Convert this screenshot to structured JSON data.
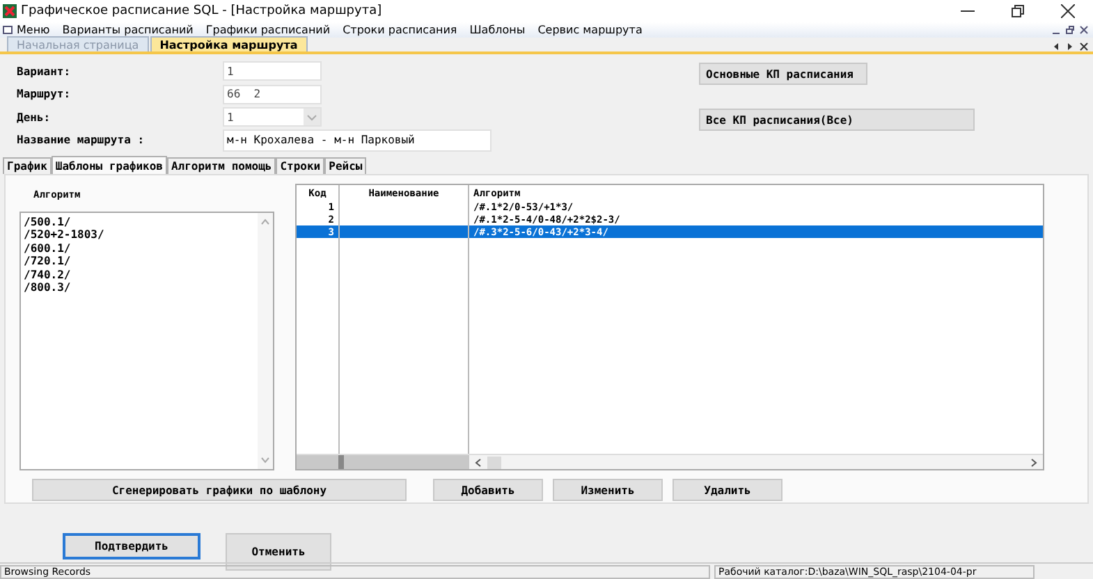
{
  "window": {
    "title": "Графическое расписание SQL - [Настройка маршрута]"
  },
  "menu": [
    "Меню",
    "Варианты расписаний",
    "Графики расписаний",
    "Строки расписания",
    "Шаблоны",
    "Сервис маршрута"
  ],
  "doc_tabs": [
    {
      "label": "Начальная страница",
      "selected": false
    },
    {
      "label": "Настройка маршрута",
      "selected": true
    }
  ],
  "fields": [
    {
      "label": "Вариант:",
      "value": "1",
      "kind": "text"
    },
    {
      "label": "Маршрут:",
      "value": "66  2",
      "kind": "text"
    },
    {
      "label": "День:",
      "value": "1",
      "kind": "select"
    },
    {
      "label": "Название маршрута :",
      "value": "м-н Крохалева - м-н Парковый",
      "kind": "wide"
    }
  ],
  "side_buttons": [
    "Основные КП расписания",
    "Все КП расписания(Все)"
  ],
  "tabs": [
    {
      "label": "График",
      "selected": false
    },
    {
      "label": "Шаблоны графиков",
      "selected": true
    },
    {
      "label": "Алгоритм помощь",
      "selected": false
    },
    {
      "label": "Строки",
      "selected": false
    },
    {
      "label": "Рейсы",
      "selected": false
    }
  ],
  "algorithms": {
    "header": "Алгоритм",
    "items": [
      "/500.1/",
      "/520+2-1803/",
      "/600.1/",
      "/720.1/",
      "/740.2/",
      "/800.3/"
    ]
  },
  "table": {
    "columns": [
      "Код",
      "Наименование",
      "Алгоритм"
    ],
    "rows": [
      {
        "cells": [
          "1",
          "",
          "/#.1*2/0-53/+1*3/"
        ],
        "selected": false
      },
      {
        "cells": [
          "2",
          "",
          "/#.1*2-5-4/0-48/+2*2$2-3/"
        ],
        "selected": false
      },
      {
        "cells": [
          "3",
          "",
          "/#.3*2-5-6/0-43/+2*3-4/"
        ],
        "selected": true
      }
    ]
  },
  "panel_buttons": [
    "Сгенерировать графики по шаблону",
    "Добавить",
    "Изменить",
    "Удалить"
  ],
  "dialog_buttons": [
    {
      "label": "Подтвердить",
      "focused": true
    },
    {
      "label": "Отменить",
      "focused": false
    }
  ],
  "status_bar": [
    "Browsing Records",
    "Рабочий каталог:D:\\baza\\WIN_SQL_rasp\\2104-04-pr"
  ]
}
